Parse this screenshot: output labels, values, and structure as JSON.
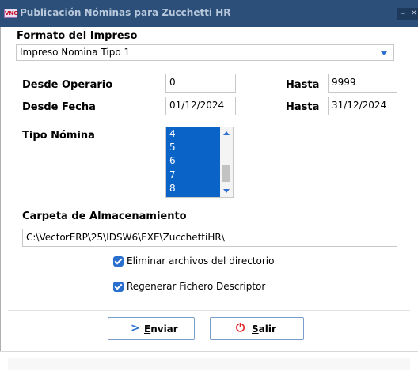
{
  "window": {
    "title": "Publicación Nóminas para Zucchetti HR",
    "app_icon_text": "VNO",
    "minimize_glyph": "–",
    "close_glyph": "×"
  },
  "formato": {
    "label": "Formato del Impreso",
    "selected": "Impreso Nomina Tipo 1"
  },
  "operario": {
    "desde_label": "Desde Operario",
    "desde_value": "0",
    "hasta_label": "Hasta",
    "hasta_value": "9999"
  },
  "fecha": {
    "desde_label": "Desde Fecha",
    "desde_value": "01/12/2024",
    "hasta_label": "Hasta",
    "hasta_value": "31/12/2024"
  },
  "tipo_nomina": {
    "label": "Tipo Nómina",
    "items": [
      "4",
      "5",
      "6",
      "7",
      "8"
    ]
  },
  "carpeta": {
    "label": "Carpeta de Almacenamiento",
    "value": "C:\\VectorERP\\25\\IDSW6\\EXE\\ZucchettiHR\\"
  },
  "options": {
    "eliminar_label": "Eliminar archivos del directorio",
    "eliminar_checked": true,
    "regenerar_label": "Regenerar Fichero Descriptor",
    "regenerar_checked": true
  },
  "buttons": {
    "enviar_first": "E",
    "enviar_rest": "nviar",
    "enviar_icon": "arrow-right-icon",
    "salir_first": "S",
    "salir_rest": "alir",
    "salir_icon": "power-icon"
  },
  "colors": {
    "titlebar": "#2b4f79",
    "accent": "#2a6fce",
    "selection": "#0a64c8",
    "salir_icon": "#e0242b"
  }
}
